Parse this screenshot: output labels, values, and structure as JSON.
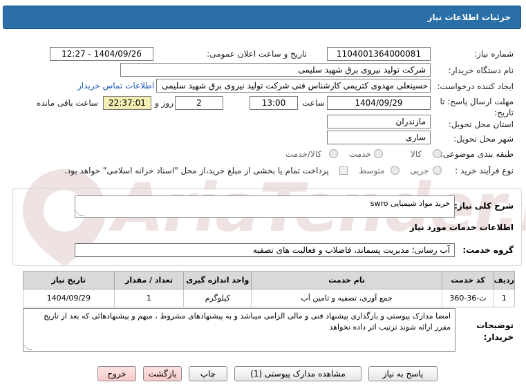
{
  "header": {
    "title": "جزئیات اطلاعات نیاز"
  },
  "fields": {
    "need_number_label": "شماره نیاز:",
    "need_number": "1104001364000081",
    "announce_label": "تاریخ و ساعت اعلان عمومی:",
    "announce_value": "1404/09/26 - 12:27",
    "buyer_org_label": "نام دستگاه خریدار:",
    "buyer_org": "شرکت تولید نیروی برق شهید سلیمی",
    "creator_label": "ایجاد کننده درخواست:",
    "creator": "حسینعلی مهدوی کتریمی کارشناس فنی شرکت تولید نیروی برق شهید سلیمی",
    "contact_link": "اطلاعات تماس خریدار",
    "deadline_label": "مهلت ارسال پاسخ: تا تاریخ:",
    "deadline_date": "1404/09/29",
    "time_label": "ساعت",
    "deadline_time": "13:00",
    "days_value": "2",
    "days_label": "روز و",
    "remaining_time": "22:37:01",
    "remaining_label": "ساعت باقی مانده",
    "province_label": "استان محل تحویل:",
    "province": "مازندران",
    "city_label": "شهر محل تحویل:",
    "city": "ساری",
    "category_label": "طبقه بندی موضوعی:",
    "category_options": [
      "کالا",
      "خدمت",
      "کالا/خدمت"
    ],
    "process_label": "نوع فرآیند خرید :",
    "process_options": [
      "جزیی",
      "متوسط"
    ],
    "payment_note": "پرداخت تمام یا بخشی از مبلغ خرید،از محل \"اسناد خزانه اسلامی\" خواهد بود."
  },
  "summary": {
    "label": "شرح کلی نیاز:",
    "value": "خرید مواد شیمیایی swro"
  },
  "services": {
    "section_title": "اطلاعات خدمات مورد نیاز",
    "group_label": "گروه خدمت:",
    "group_value": "آب رسانی؛ مدیریت پسماند، فاضلاب و فعالیت های تصفیه",
    "table": {
      "headers": [
        "ردیف",
        "کد خدمت",
        "نام خدمت",
        "واحد اندازه گیری",
        "تعداد / مقدار",
        "تاریخ نیاز"
      ],
      "rows": [
        [
          "1",
          "ث-36-360",
          "جمع آوری، تصفیه و تامین آب",
          "کیلوگرم",
          "1",
          "1404/09/29"
        ]
      ]
    }
  },
  "notes": {
    "label": "توضیحات خریدار:",
    "text": "امضا مدارک پیوستی و بارگذاری پیشنهاد فنی و مالی الزامی میباشد و به پیشنهادهای مشروط ، مبهم و پیشنهادهائی که بعد از تاریخ مقرر ارائه شوند ترتیب اثر داده نخواهد"
  },
  "buttons": {
    "reply": "پاسخ به نیاز",
    "attachments": "مشاهده مدارک پیوستی (1)",
    "print": "چاپ",
    "back": "بازگشت",
    "exit": "خروج"
  },
  "watermark": {
    "text": "AriaTender.neT"
  },
  "colors": {
    "header_bg": "#2a6fa8",
    "highlight": "#f3eeb1",
    "link": "#1c5bb8",
    "button_pink": "#f6caca"
  }
}
